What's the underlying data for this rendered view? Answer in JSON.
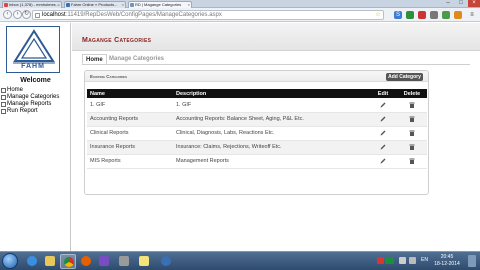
{
  "browser": {
    "tabs": [
      {
        "label": "Inbox (1,378) - mmholmes..."
      },
      {
        "label": "Fahm Online » Products..."
      },
      {
        "label": "RD | Magange Categories"
      }
    ],
    "url_host": "localhost",
    "url_rest": ":11419/RepDesWeb/ConfigPages/ManageCategories.aspx"
  },
  "sidebar": {
    "logo_text": "FAHM",
    "welcome": "Welcome",
    "items": [
      {
        "label": "Home"
      },
      {
        "label": "Manage Categories"
      },
      {
        "label": "Manage Reports"
      },
      {
        "label": "Run Report"
      }
    ]
  },
  "header": {
    "title": "Magange Categories"
  },
  "tabs": [
    {
      "label": "Home"
    },
    {
      "label": "Manage Categories"
    }
  ],
  "panel": {
    "title": "Existing Categories",
    "add_button": "Add Category",
    "columns": {
      "name": "Name",
      "description": "Description",
      "edit": "Edit",
      "delete": "Delete"
    },
    "rows": [
      {
        "name": "1. GIF",
        "description": "1. GIF"
      },
      {
        "name": "Accounting Reports",
        "description": "Accounting Reports: Balance Sheet, Aging, P&L Etc."
      },
      {
        "name": "Clinical Reports",
        "description": "Clinical, Diagnosis, Labs, Reactions Etc."
      },
      {
        "name": "Insurance Reports",
        "description": "Insurance: Claims, Rejections, Writeoff Etc."
      },
      {
        "name": "MIS Reports",
        "description": "Management Reports"
      }
    ]
  },
  "taskbar": {
    "time": "20:45",
    "date": "18-12-2014",
    "lang": "EN"
  },
  "colors": {
    "title_red": "#8a1f1f",
    "header_black": "#111111",
    "logo_blue": "#2f5a94"
  }
}
